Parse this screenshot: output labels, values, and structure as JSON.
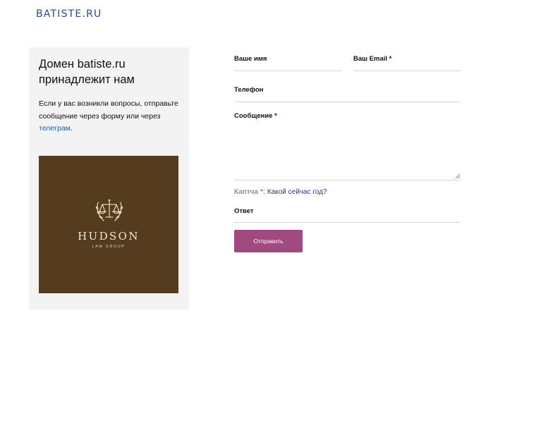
{
  "header": {
    "logo": "BATISTE.RU"
  },
  "info": {
    "title": "Домен batiste.ru принадлежит нам",
    "text_before_link": "Если у вас возникли вопросы, отправьте сообщение через форму или через ",
    "link_text": "телеграм",
    "text_after_link": "."
  },
  "brand_image": {
    "name": "HUDSON",
    "subtitle": "LAW GROUP",
    "emblem_icon": "scales-of-justice-laurel-icon",
    "background_color": "#553c1e",
    "text_color": "#efe6d6"
  },
  "form": {
    "name_label": "Ваше имя",
    "name_value": "",
    "email_label": "Ваш Email *",
    "email_value": "",
    "phone_label": "Телефон",
    "phone_value": "",
    "message_label": "Сообщение *",
    "message_value": "",
    "captcha_label": "Каптча *:",
    "captcha_question": "Какой сейчас год?",
    "answer_label": "Ответ",
    "answer_value": "",
    "submit_label": "Отправить"
  },
  "colors": {
    "logo": "#2a4a8c",
    "link": "#1f5bc4",
    "button": "#a04a80",
    "card_background": "#f3f3f3"
  }
}
